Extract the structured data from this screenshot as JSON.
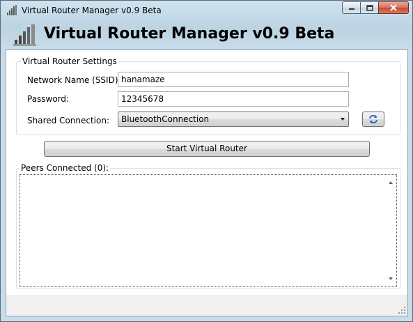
{
  "window": {
    "title": "Virtual Router Manager v0.9 Beta",
    "icon": "signal-bars-icon",
    "caption_buttons": [
      "minimize-icon",
      "maximize-icon",
      "close-icon"
    ]
  },
  "header": {
    "title": "Virtual Router Manager v0.9 Beta",
    "icon": "signal-bars-icon"
  },
  "settings": {
    "group_title": "Virtual Router Settings",
    "ssid_label": "Network Name (SSID):",
    "ssid_value": "hanamaze",
    "password_label": "Password:",
    "password_value": "12345678",
    "shared_label": "Shared Connection:",
    "shared_value": "BluetoothConnection",
    "refresh_icon": "refresh-icon"
  },
  "actions": {
    "start_label": "Start Virtual Router"
  },
  "peers": {
    "group_title": "Peers Connected (0):"
  },
  "colors": {
    "chrome": "#bcd3e2",
    "close_button": "#c24a32",
    "refresh_arrow": "#2a6ac8"
  }
}
